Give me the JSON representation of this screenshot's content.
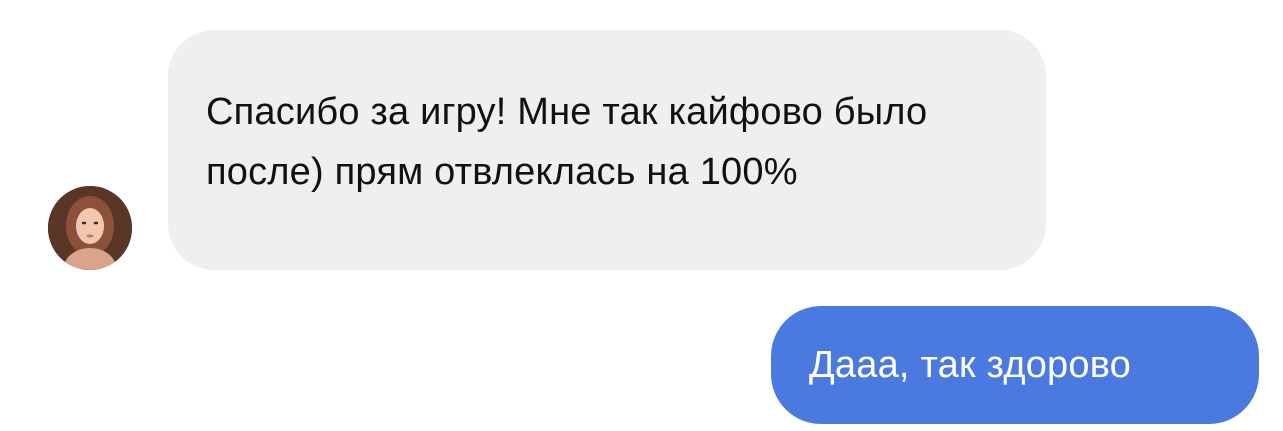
{
  "conversation": {
    "incoming": {
      "avatar_icon": "user-avatar-photo",
      "text": "Спасибо за игру! Мне так кайфово было после) прям отвлеклась на 100%"
    },
    "outgoing": {
      "text": "Дааа, так здорово",
      "bubble_color": "#4a7ae0"
    },
    "incoming_bubble_color": "#efefef"
  }
}
